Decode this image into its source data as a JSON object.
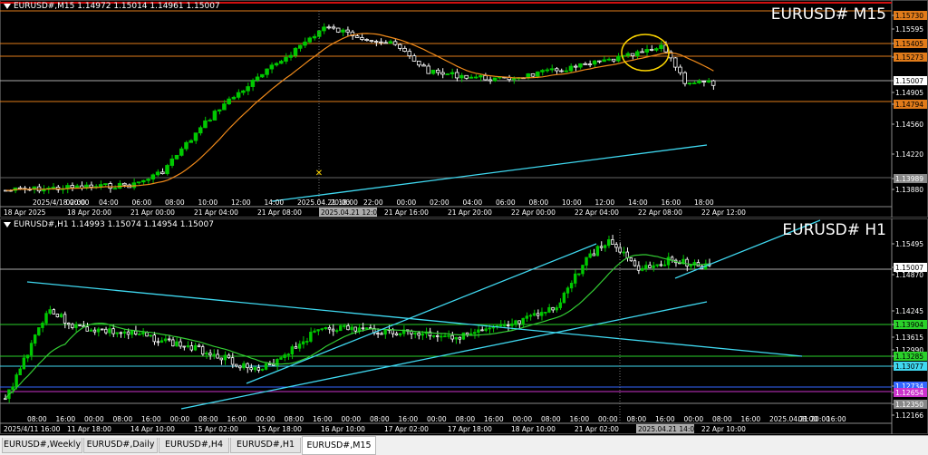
{
  "top_chart": {
    "symbol_line": "EURUSD#,M15  1.14972 1.15014 1.14961 1.15007",
    "big_name": "EURUSD# M15",
    "price_labels": [
      {
        "text": "1.15730",
        "kind": "orange"
      },
      {
        "text": "1.15595",
        "kind": "plain"
      },
      {
        "text": "1.15405",
        "kind": "orange"
      },
      {
        "text": "1.15273",
        "kind": "orange"
      },
      {
        "text": "1.15007",
        "kind": "white"
      },
      {
        "text": "1.14905",
        "kind": "plain"
      },
      {
        "text": "1.14794",
        "kind": "orange"
      },
      {
        "text": "1.14560",
        "kind": "plain"
      },
      {
        "text": "1.14220",
        "kind": "plain"
      },
      {
        "text": "1.13989",
        "kind": "gray"
      },
      {
        "text": "1.13880",
        "kind": "plain"
      }
    ],
    "time_labels": [
      "18 Apr 2025",
      "18 Apr 20:00",
      "21 Apr 00:00",
      "21 Apr 04:00",
      "21 Apr 08:00",
      "2025.04.21 12:00",
      "21 Apr 16:00",
      "21 Apr 20:00",
      "22 Apr 00:00",
      "22 Apr 04:00",
      "22 Apr 08:00",
      "22 Apr 12:00"
    ],
    "hour_labels": [
      "2025/4/18 00:00",
      "02:00",
      "04:00",
      "06:00",
      "08:00",
      "10:00",
      "12:00",
      "14:00",
      "2025.04.21 18:00",
      "20:00",
      "22:00",
      "00:00",
      "02:00",
      "04:00",
      "06:00",
      "08:00",
      "10:00",
      "12:00",
      "14:00",
      "16:00",
      "18:00"
    ],
    "crosshair_time": "2025.04.21 18:00",
    "crosshair_time_bottom": "2025.04.21 12:00"
  },
  "bottom_chart": {
    "symbol_line": "EURUSD#,H1  1.14993 1.15074 1.14954 1.15007",
    "big_name": "EURUSD# H1",
    "price_labels": [
      {
        "text": "1.15495",
        "kind": "plain"
      },
      {
        "text": "1.15007",
        "kind": "white"
      },
      {
        "text": "1.14870",
        "kind": "plain"
      },
      {
        "text": "1.14245",
        "kind": "plain"
      },
      {
        "text": "1.13904",
        "kind": "green"
      },
      {
        "text": "1.13615",
        "kind": "plain"
      },
      {
        "text": "1.12990",
        "kind": "plain"
      },
      {
        "text": "1.13285",
        "kind": "green"
      },
      {
        "text": "1.13077",
        "kind": "cyan"
      },
      {
        "text": "1.12734",
        "kind": "blue"
      },
      {
        "text": "1.12654",
        "kind": "magenta"
      },
      {
        "text": "1.12350",
        "kind": "gray"
      },
      {
        "text": "1.12166",
        "kind": "plain"
      }
    ],
    "time_labels": [
      "2025/4/11 16:00",
      "11 Apr 18:00",
      "14 Apr 10:00",
      "15 Apr 02:00",
      "15 Apr 18:00",
      "16 Apr 10:00",
      "17 Apr 02:00",
      "17 Apr 18:00",
      "18 Apr 10:00",
      "21 Apr 02:00",
      "2025.04.21 14:00",
      "22 Apr 10:00"
    ],
    "hour_labels": [
      "08:00",
      "16:00",
      "00:00",
      "08:00",
      "16:00",
      "00:00",
      "08:00",
      "16:00",
      "00:00",
      "08:00",
      "16:00",
      "00:00",
      "08:00",
      "16:00",
      "00:00",
      "08:00",
      "16:00",
      "00:00",
      "08:00",
      "16:00",
      "00:00",
      "08:00",
      "16:00",
      "00:00",
      "08:00",
      "16:00",
      "2025.04.21 20:00",
      "08:00",
      "16:00"
    ],
    "crosshair_time": "2025.04.21 20:00",
    "crosshair_time_bottom": "2025.04.21 14:00"
  },
  "tabs": [
    {
      "label": "EURUSD#,Weekly",
      "active": false
    },
    {
      "label": "EURUSD#,Daily",
      "active": false
    },
    {
      "label": "EURUSD#,H4",
      "active": false
    },
    {
      "label": "EURUSD#,H1",
      "active": false
    },
    {
      "label": "EURUSD#,M15",
      "active": true
    }
  ],
  "colors": {
    "bull": "#00c800",
    "bear": "#ffffff",
    "orange": "#e07b1a",
    "cyan": "#3fd8f0",
    "green": "#2ad02a",
    "ma_green": "#33cc33",
    "ma_orange": "#f08a1a",
    "grid": "#1c2a1c",
    "yellow": "#ffd700"
  }
}
